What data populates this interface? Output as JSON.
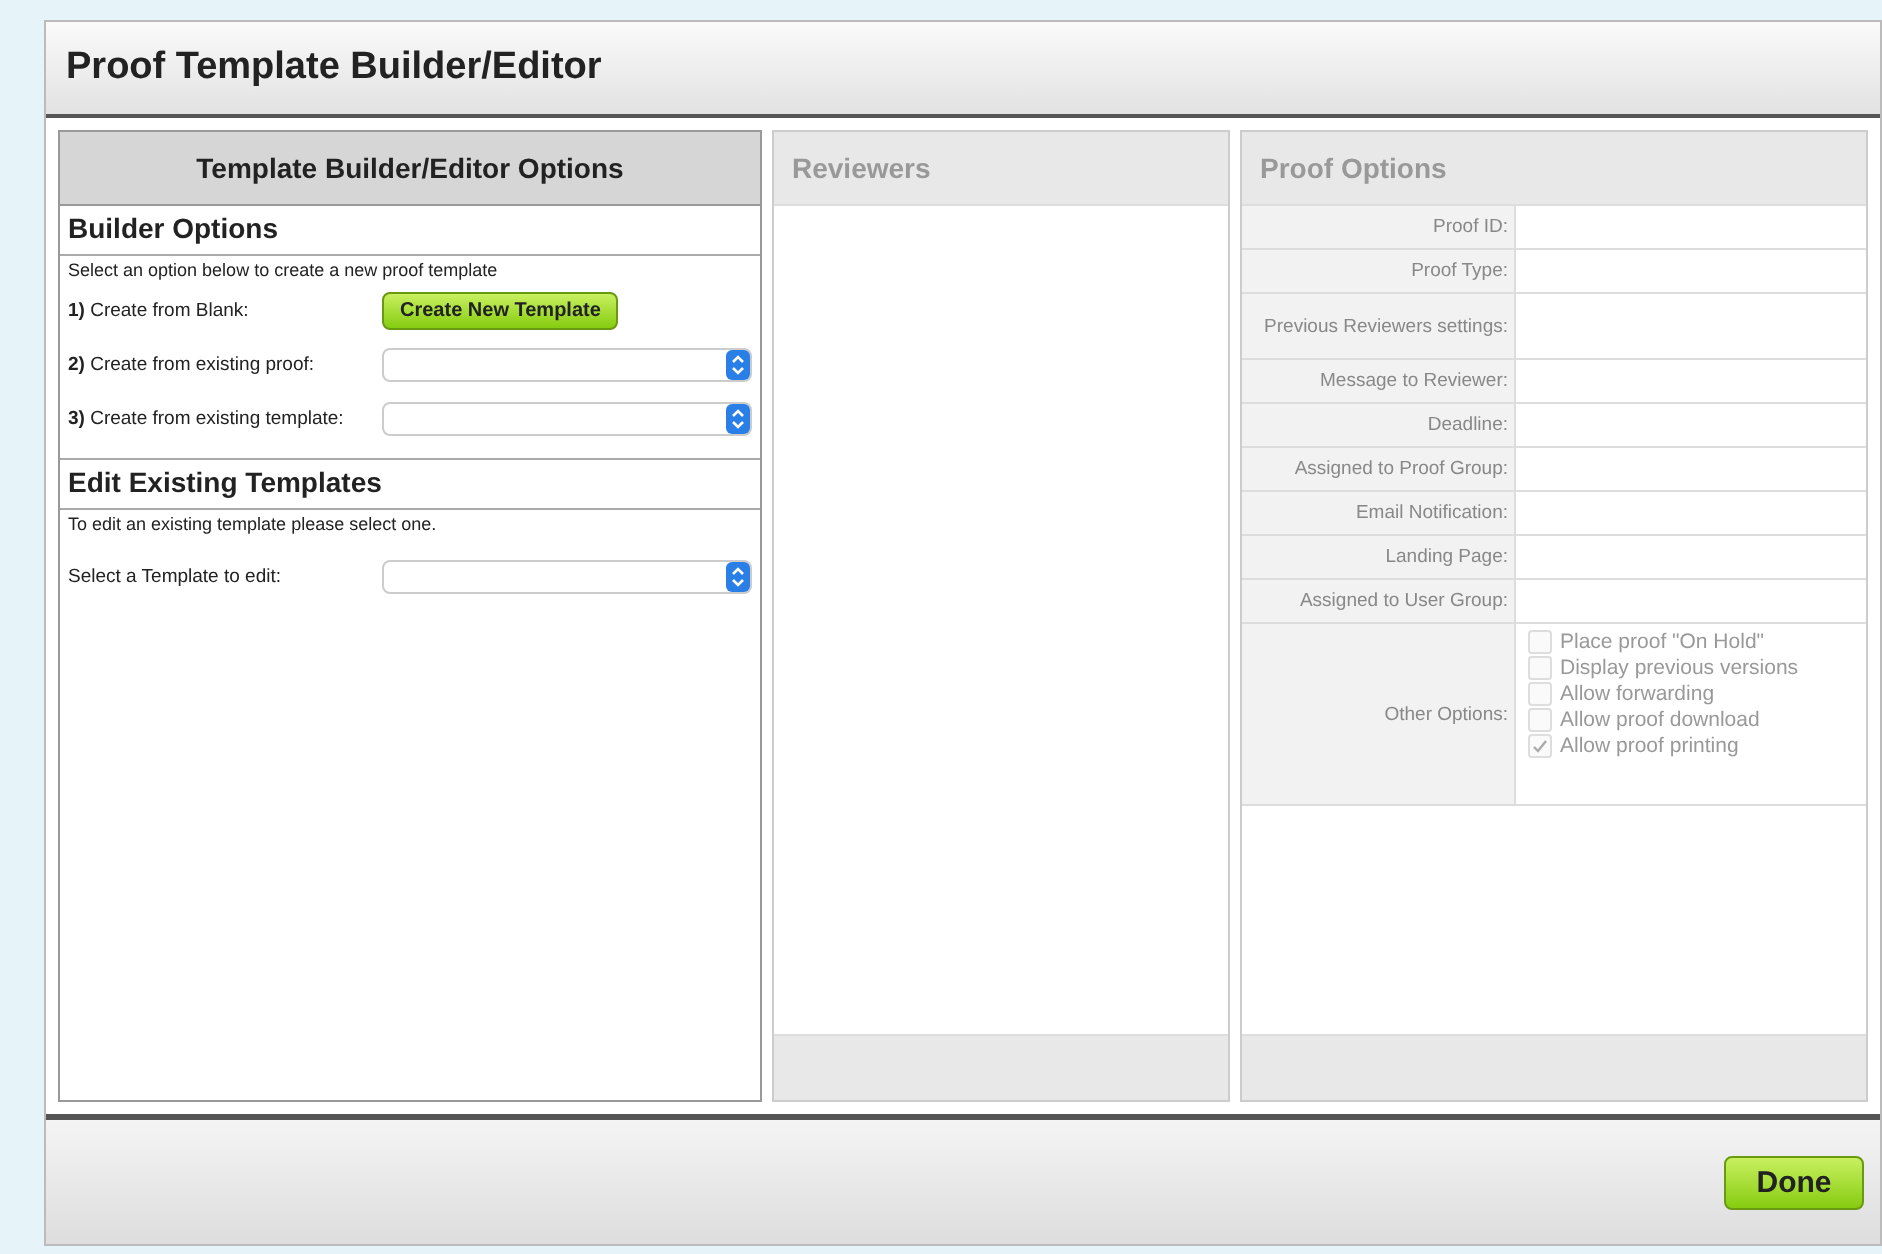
{
  "window": {
    "title": "Proof Template Builder/Editor"
  },
  "builder_panel": {
    "title": "Template Builder/Editor Options",
    "sections": [
      {
        "heading": "Builder Options",
        "description": "Select an option below to create a new proof template",
        "rows": [
          {
            "kind": "button",
            "label": "**1)** Create from Blank:",
            "button": "Create New Template"
          },
          {
            "kind": "select",
            "label": "**2)** Create from existing proof:"
          },
          {
            "kind": "select",
            "label": "**3)** Create from existing template:"
          }
        ]
      },
      {
        "heading": "Edit Existing Templates",
        "description": "To edit an existing template please select one.",
        "rows": [
          {
            "kind": "select",
            "label": "Select a Template to edit:"
          }
        ]
      }
    ]
  },
  "reviewers_panel": {
    "title": "Reviewers"
  },
  "proof_options_panel": {
    "title": "Proof Options",
    "fields": [
      {
        "kind": "text",
        "label": "Proof ID:"
      },
      {
        "kind": "text",
        "label": "Proof Type:"
      },
      {
        "kind": "text",
        "label": "Previous Reviewers settings:"
      },
      {
        "kind": "text",
        "label": "Message to Reviewer:"
      },
      {
        "kind": "text",
        "label": "Deadline:"
      },
      {
        "kind": "text",
        "label": "Assigned to Proof Group:"
      },
      {
        "kind": "text",
        "label": "Email Notification:"
      },
      {
        "kind": "text",
        "label": "Landing Page:"
      },
      {
        "kind": "text",
        "label": "Assigned to User Group:"
      },
      {
        "kind": "checkboxes",
        "label": "Other Options:",
        "options": [
          {
            "label": "Place proof \"On Hold\"",
            "checked": false
          },
          {
            "label": "Display previous versions",
            "checked": false
          },
          {
            "label": "Allow forwarding",
            "checked": false
          },
          {
            "label": "Allow proof download",
            "checked": false
          },
          {
            "label": "Allow proof printing",
            "checked": true
          }
        ]
      }
    ]
  },
  "footer": {
    "buttons": [
      "Done"
    ]
  }
}
